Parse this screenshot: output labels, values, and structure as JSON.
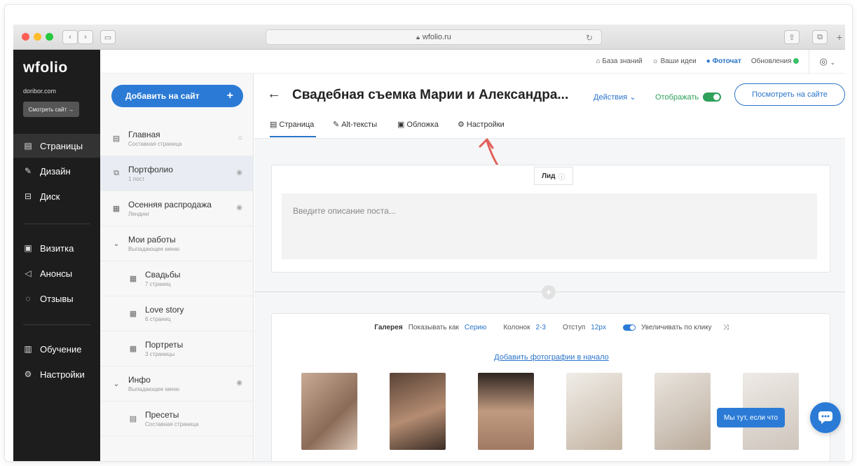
{
  "browser": {
    "url": "wfolio.ru",
    "traffic_lights": [
      "#ff5f57",
      "#febc2e",
      "#28c840"
    ]
  },
  "sidebar": {
    "logo": "wfolio",
    "domain": "doribor.com",
    "view_site": "Смотреть сайт →",
    "items": [
      {
        "label": "Страницы",
        "icon": "page-icon"
      },
      {
        "label": "Дизайн",
        "icon": "brush-icon"
      },
      {
        "label": "Диск",
        "icon": "disk-icon"
      },
      {
        "label": "Визитка",
        "icon": "card-icon"
      },
      {
        "label": "Анонсы",
        "icon": "megaphone-icon"
      },
      {
        "label": "Отзывы",
        "icon": "chat-icon"
      },
      {
        "label": "Обучение",
        "icon": "book-icon"
      },
      {
        "label": "Настройки",
        "icon": "gear-icon"
      }
    ]
  },
  "topbar": {
    "knowledge": "База знаний",
    "ideas": "Ваши идеи",
    "photochat": "Фоточат",
    "updates": "Обновления"
  },
  "pages_panel": {
    "add_button": "Добавить на сайт",
    "add_plus": "+",
    "items": [
      {
        "title": "Главная",
        "sub": "Составная страница"
      },
      {
        "title": "Портфолио",
        "sub": "1 пост"
      },
      {
        "title": "Осенняя распродажа",
        "sub": "Лендинг"
      },
      {
        "title": "Мои работы",
        "sub": "Выпадающее меню"
      },
      {
        "title": "Свадьбы",
        "sub": "7 страниц"
      },
      {
        "title": "Love story",
        "sub": "6 страниц"
      },
      {
        "title": "Портреты",
        "sub": "3 страницы"
      },
      {
        "title": "Инфо",
        "sub": "Выпадающее меню"
      },
      {
        "title": "Пресеты",
        "sub": "Составная страница"
      }
    ]
  },
  "editor": {
    "back": "←",
    "title": "Свадебная съемка Марии и Александра...",
    "actions": "Действия",
    "show": "Отображать",
    "view_site": "Посмотреть на сайте",
    "tabs": [
      "Страница",
      "Alt-тексты",
      "Обложка",
      "Настройки"
    ],
    "lead_label": "Лид",
    "lead_placeholder": "Введите описание поста...",
    "gallery": {
      "label": "Галерея",
      "show_as_label": "Показывать как",
      "show_as_value": "Серию",
      "columns_label": "Колонок",
      "columns_value": "2-3",
      "gap_label": "Отступ",
      "gap_value": "12px",
      "zoom_label": "Увеличивать по клику",
      "add_photos": "Добавить фотографии в начало"
    }
  },
  "chat": {
    "bubble": "Мы тут, если что"
  },
  "colors": {
    "accent": "#2b7bd6",
    "green": "#2ea05a",
    "sidebar_bg": "#1d1d1d",
    "arrow": "#e2605a"
  }
}
